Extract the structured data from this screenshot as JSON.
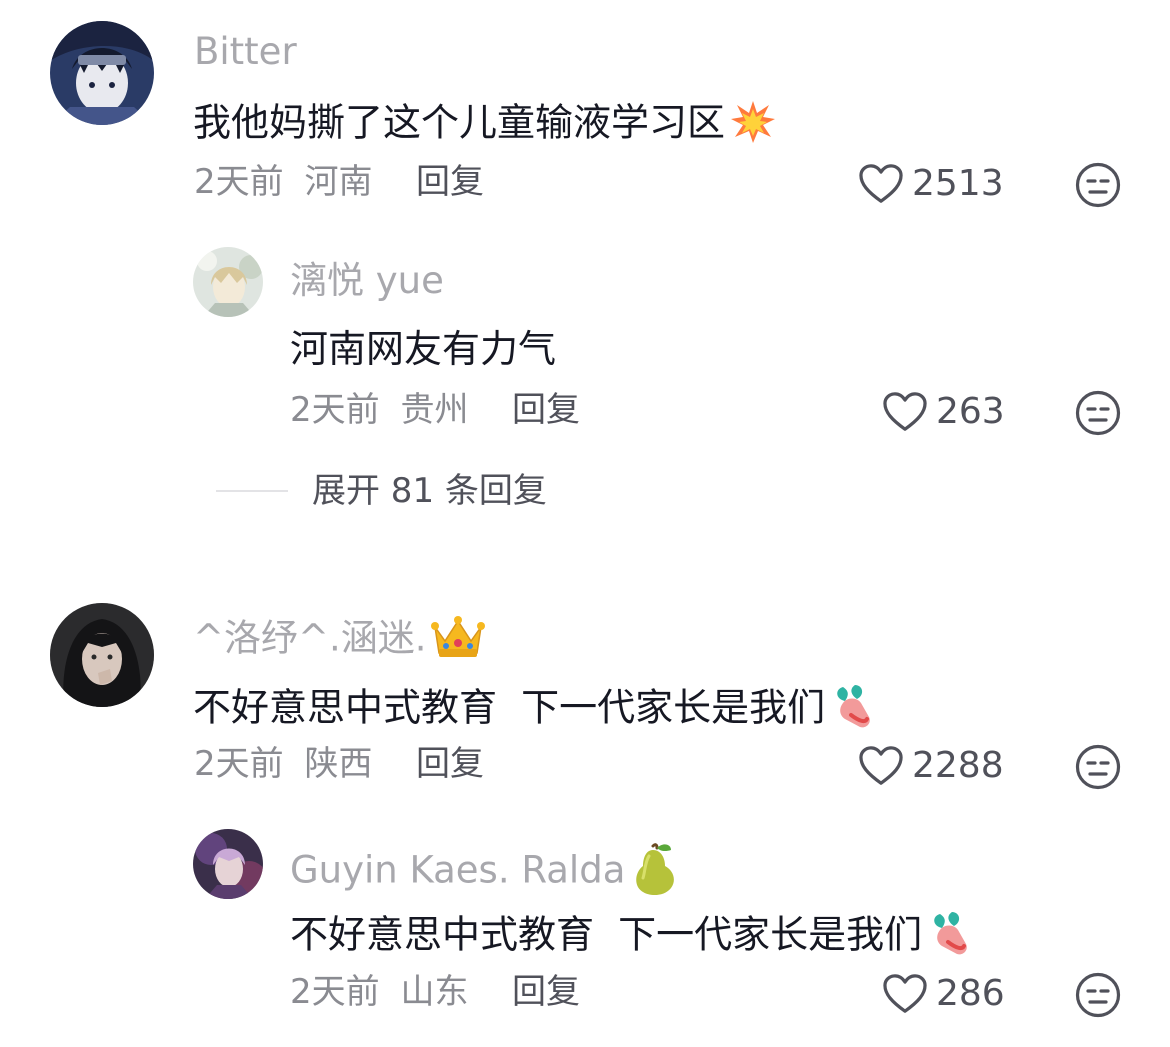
{
  "comments": [
    {
      "username": "Bitter",
      "text": "我他妈撕了这个儿童输液学习区",
      "text_emoji": "collision-emoji",
      "time": "2天前",
      "location": "河南",
      "reply_label": "回复",
      "likes": "2513",
      "replies": [
        {
          "username": "漓悦 yue",
          "text": "河南网友有力气",
          "time": "2天前",
          "location": "贵州",
          "reply_label": "回复",
          "likes": "263"
        }
      ],
      "expand_label": "展开 81 条回复"
    },
    {
      "username": "^洛纾^.涵迷.",
      "username_emoji": "crown-emoji",
      "text": "不好意思中式教育  下一代家长是我们",
      "text_emoji": "radish-emoji",
      "time": "2天前",
      "location": "陕西",
      "reply_label": "回复",
      "likes": "2288",
      "replies": [
        {
          "username": "Guyin Kaes. Ralda",
          "username_emoji": "pear-emoji",
          "text": "不好意思中式教育  下一代家长是我们",
          "text_emoji": "radish-emoji",
          "time": "2天前",
          "location": "山东",
          "reply_label": "回复",
          "likes": "286"
        }
      ]
    }
  ],
  "colors": {
    "username": "#a8a8ad",
    "text": "#161823",
    "meta": "#8a8b91",
    "action": "#50515a"
  }
}
